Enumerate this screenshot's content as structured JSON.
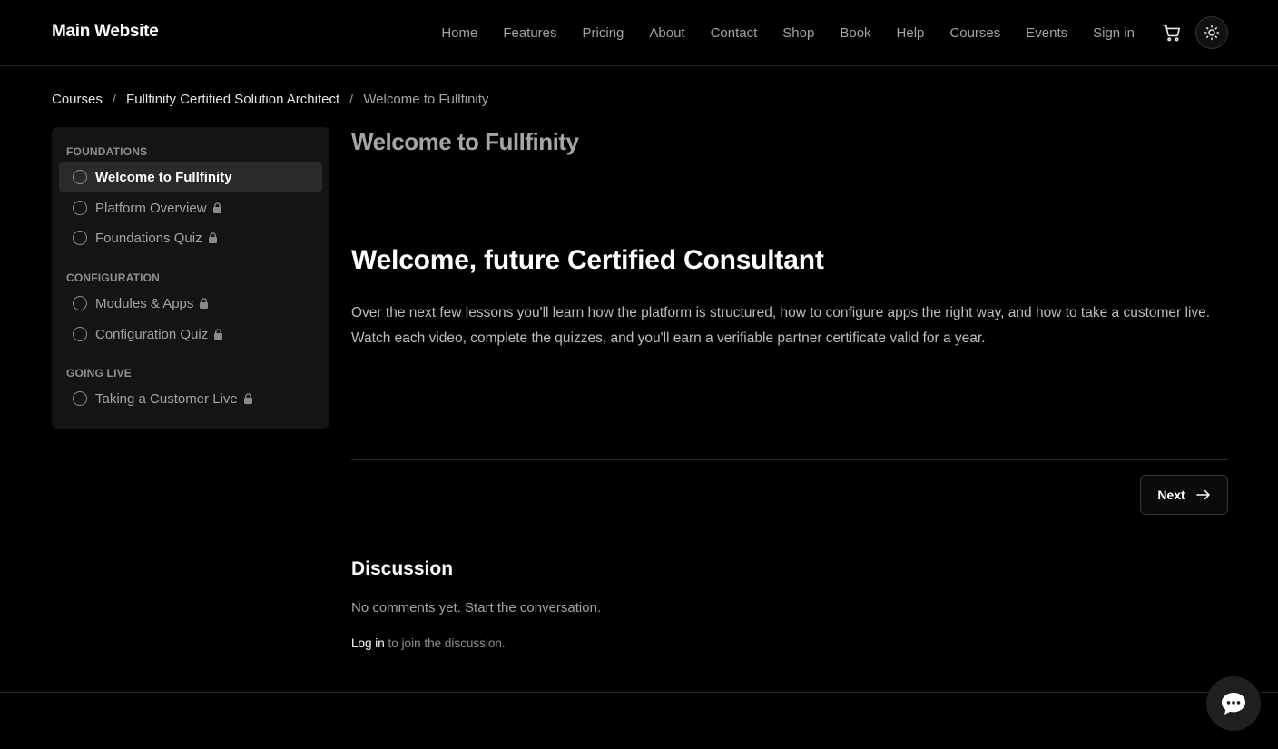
{
  "header": {
    "brand": "Main Website",
    "nav": [
      "Home",
      "Features",
      "Pricing",
      "About",
      "Contact",
      "Shop",
      "Book",
      "Help",
      "Courses",
      "Events",
      "Sign in"
    ],
    "cart_icon": "cart-icon",
    "theme_icon": "sun-icon"
  },
  "breadcrumb": {
    "items": [
      "Courses",
      "Fullfinity Certified Solution Architect"
    ],
    "separator": "/",
    "current": "Welcome to Fullfinity"
  },
  "sidebar": {
    "sections": [
      {
        "title": "FOUNDATIONS",
        "lessons": [
          {
            "label": "Welcome to Fullfinity",
            "locked": false,
            "active": true
          },
          {
            "label": "Platform Overview",
            "locked": true,
            "active": false
          },
          {
            "label": "Foundations Quiz",
            "locked": true,
            "active": false
          }
        ]
      },
      {
        "title": "CONFIGURATION",
        "lessons": [
          {
            "label": "Modules & Apps",
            "locked": true,
            "active": false
          },
          {
            "label": "Configuration Quiz",
            "locked": true,
            "active": false
          }
        ]
      },
      {
        "title": "GOING LIVE",
        "lessons": [
          {
            "label": "Taking a Customer Live",
            "locked": true,
            "active": false
          }
        ]
      }
    ]
  },
  "main": {
    "lesson_title": "Welcome to Fullfinity",
    "heading": "Welcome, future Certified Consultant",
    "body": "Over the next few lessons you'll learn how the platform is structured, how to configure apps the right way, and how to take a customer live. Watch each video, complete the quizzes, and you'll earn a verifiable partner certificate valid for a year.",
    "next_label": "Next"
  },
  "discussion": {
    "title": "Discussion",
    "empty": "No comments yet. Start the conversation.",
    "login_link": "Log in",
    "login_suffix": " to join the discussion."
  },
  "colors": {
    "background": "#000000",
    "active_item": "#2a2a2a",
    "sidebar": "#141414"
  }
}
